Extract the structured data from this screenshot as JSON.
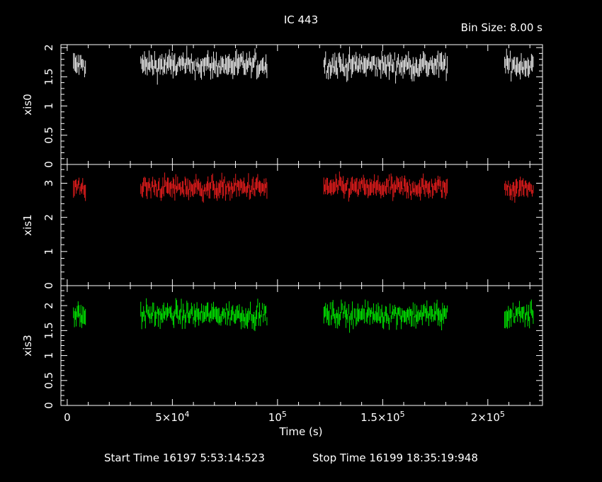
{
  "title": "IC 443",
  "bin_size_label": "Bin Size: 8.00 s",
  "xlabel": "Time (s)",
  "start_time_label": "Start Time 16197  5:53:14:523",
  "stop_time_label": "Stop Time 16199 18:35:19:948",
  "colors": {
    "background": "#000000",
    "axes": "#ffffff",
    "xis0": "#ffffff",
    "xis1": "#ff2020",
    "xis3": "#00ff00"
  },
  "x_tick_labels": [
    {
      "mant": "0",
      "exp": ""
    },
    {
      "mant": "5×10",
      "exp": "4"
    },
    {
      "mant": "10",
      "exp": "5"
    },
    {
      "mant": "1.5×10",
      "exp": "5"
    },
    {
      "mant": "2×10",
      "exp": "5"
    }
  ],
  "chart_data": [
    {
      "type": "scatter",
      "name": "xis0",
      "ylabel": "xis0",
      "xlim": [
        -3000,
        226000
      ],
      "ylim": [
        0,
        2.05
      ],
      "x_ticks": [
        0,
        50000,
        100000,
        150000,
        200000
      ],
      "y_ticks": [
        0,
        0.5,
        1,
        1.5,
        2
      ],
      "y_tick_labels": [
        "0",
        "0.5",
        "1",
        "1.5",
        "2"
      ],
      "segments": [
        [
          3000,
          9000
        ],
        [
          35000,
          95000
        ],
        [
          122000,
          181000
        ],
        [
          208000,
          222000
        ]
      ],
      "mean": 1.7,
      "spread": 0.12,
      "min_value": 1.3,
      "max_value": 2.0
    },
    {
      "type": "scatter",
      "name": "xis1",
      "ylabel": "xis1",
      "xlim": [
        -3000,
        226000
      ],
      "ylim": [
        0,
        3.55
      ],
      "x_ticks": [
        0,
        50000,
        100000,
        150000,
        200000
      ],
      "y_ticks": [
        0,
        1,
        2,
        3
      ],
      "y_tick_labels": [
        "0",
        "1",
        "2",
        "3"
      ],
      "segments": [
        [
          3000,
          9000
        ],
        [
          35000,
          95000
        ],
        [
          122000,
          181000
        ],
        [
          208000,
          222000
        ]
      ],
      "mean": 2.87,
      "spread": 0.18,
      "min_value": 2.35,
      "max_value": 3.5
    },
    {
      "type": "scatter",
      "name": "xis3",
      "ylabel": "xis3",
      "xlim": [
        -3000,
        226000
      ],
      "ylim": [
        0,
        2.4
      ],
      "x_ticks": [
        0,
        50000,
        100000,
        150000,
        200000
      ],
      "y_ticks": [
        0,
        0.5,
        1,
        1.5,
        2
      ],
      "y_tick_labels": [
        "0",
        "0.5",
        "1",
        "1.5",
        "2"
      ],
      "segments": [
        [
          3000,
          9000
        ],
        [
          35000,
          95000
        ],
        [
          122000,
          181000
        ],
        [
          208000,
          222000
        ]
      ],
      "mean": 1.82,
      "spread": 0.13,
      "min_value": 1.25,
      "max_value": 2.4
    }
  ]
}
